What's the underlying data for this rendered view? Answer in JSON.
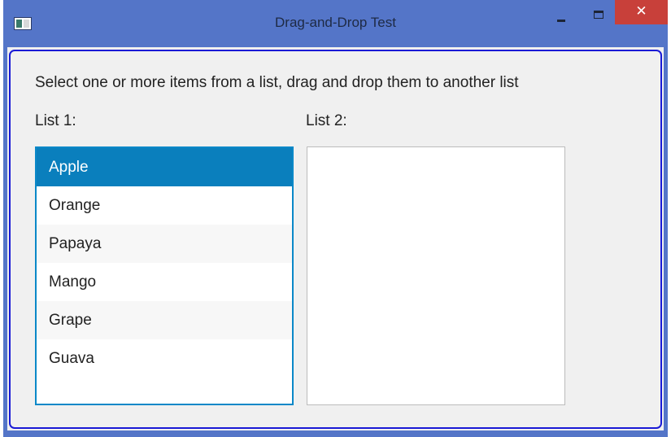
{
  "window": {
    "title": "Drag-and-Drop Test",
    "close_glyph": "✕",
    "accent_color": "#5475c8",
    "close_color": "#c8403a"
  },
  "main": {
    "instruction": "Select one or more items from a list, drag and drop them to another list",
    "list1_label": "List 1:",
    "list2_label": "List 2:"
  },
  "list1": {
    "items": [
      {
        "label": "Apple",
        "selected": true
      },
      {
        "label": "Orange",
        "selected": false
      },
      {
        "label": "Papaya",
        "selected": false
      },
      {
        "label": "Mango",
        "selected": false
      },
      {
        "label": "Grape",
        "selected": false
      },
      {
        "label": "Guava",
        "selected": false
      }
    ],
    "selection_color": "#0a7fbd"
  },
  "list2": {
    "items": []
  }
}
